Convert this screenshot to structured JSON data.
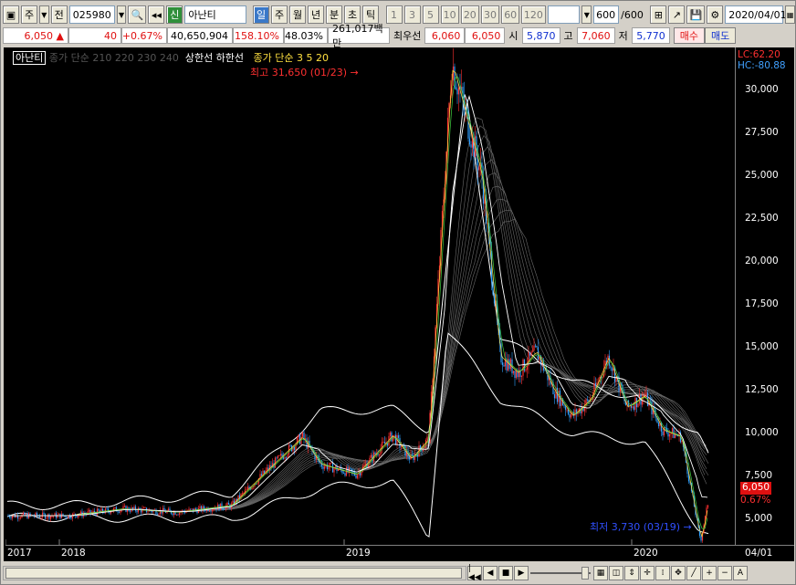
{
  "toolbar": {
    "market_type": "주",
    "prev_label": "전",
    "stock_code": "025980",
    "credit_badge": "신",
    "stock_name": "아난티",
    "periods": [
      "일",
      "주",
      "월",
      "년",
      "분",
      "초",
      "틱"
    ],
    "selected_period": "일",
    "intervals": [
      "1",
      "3",
      "5",
      "10",
      "20",
      "30",
      "60",
      "120"
    ],
    "count": "600",
    "count_total": "/600",
    "date": "2020/04/01"
  },
  "quote": {
    "price": "6,050",
    "change": "40",
    "change_pct": "+0.67%",
    "volume": "40,650,904",
    "volume_ratio": "158.10%",
    "turnover": "48.03%",
    "amount": "261,017백만",
    "best_label": "최우선",
    "ask": "6,060",
    "bid": "6,050",
    "open_label": "시",
    "open": "5,870",
    "high_label": "고",
    "high": "7,060",
    "low_label": "저",
    "low": "5,770",
    "buy_label": "매수",
    "sell_label": "매도"
  },
  "chart": {
    "legend_name": "아난티",
    "legend_ma_long": "종가 단순 210 220 230 240",
    "legend_limits": "상한선  하한선",
    "legend_ma_short": "종가 단순 3  5  20",
    "lc": "LC:62.20",
    "hc": "HC:-80.88",
    "last_price": "6,050",
    "last_pct": "0.67%",
    "high_note": "최고 31,650 (01/23) →",
    "low_note": "최저 3,730 (03/19) →",
    "up_color": "#ff3030",
    "down_color": "#30a0ff"
  },
  "chart_data": {
    "type": "line",
    "title": "아난티",
    "yticks": [
      "30,000",
      "27,500",
      "25,000",
      "22,500",
      "20,000",
      "17,500",
      "15,000",
      "12,500",
      "10,000",
      "7,500",
      "5,000"
    ],
    "ylim": [
      3500,
      32500
    ],
    "xticks": [
      "2017",
      "2018",
      "2019",
      "2020",
      "04/01"
    ],
    "series": [
      {
        "name": "종가",
        "x": [
          "2017-04",
          "2017-07",
          "2017-10",
          "2018-01",
          "2018-03",
          "2018-05",
          "2018-06",
          "2018-08",
          "2018-10",
          "2018-11",
          "2018-12",
          "2019-01-23",
          "2019-03",
          "2019-04",
          "2019-05",
          "2019-06",
          "2019-07",
          "2019-08",
          "2019-09",
          "2019-10",
          "2019-11",
          "2019-12",
          "2020-01",
          "2020-02",
          "2020-03-19",
          "2020-04-01"
        ],
        "values": [
          5200,
          5600,
          5400,
          5800,
          7800,
          9800,
          8200,
          7600,
          9900,
          8500,
          9700,
          31650,
          25000,
          14500,
          13500,
          14800,
          12500,
          11000,
          12000,
          14500,
          11500,
          12200,
          10200,
          9800,
          3730,
          6050
        ]
      },
      {
        "name": "하한선",
        "x": [
          "2017-04",
          "2018-01",
          "2018-06",
          "2018-10",
          "2018-12",
          "2019-01",
          "2019-04",
          "2019-08",
          "2019-12",
          "2020-03",
          "2020-04"
        ],
        "values": [
          5100,
          5000,
          6800,
          7200,
          4000,
          16000,
          12000,
          10000,
          9500,
          4500,
          3800
        ]
      },
      {
        "name": "상한선",
        "x": [
          "2017-04",
          "2018-01",
          "2018-06",
          "2018-10",
          "2018-12",
          "2019-02",
          "2019-04",
          "2019-08",
          "2019-12",
          "2020-03",
          "2020-04"
        ],
        "values": [
          5800,
          6500,
          11300,
          11400,
          10200,
          30000,
          15600,
          13000,
          12000,
          10000,
          7500
        ]
      }
    ]
  },
  "bottom": {
    "zoom_in": "+",
    "zoom_out": "−",
    "text_tool": "A"
  }
}
